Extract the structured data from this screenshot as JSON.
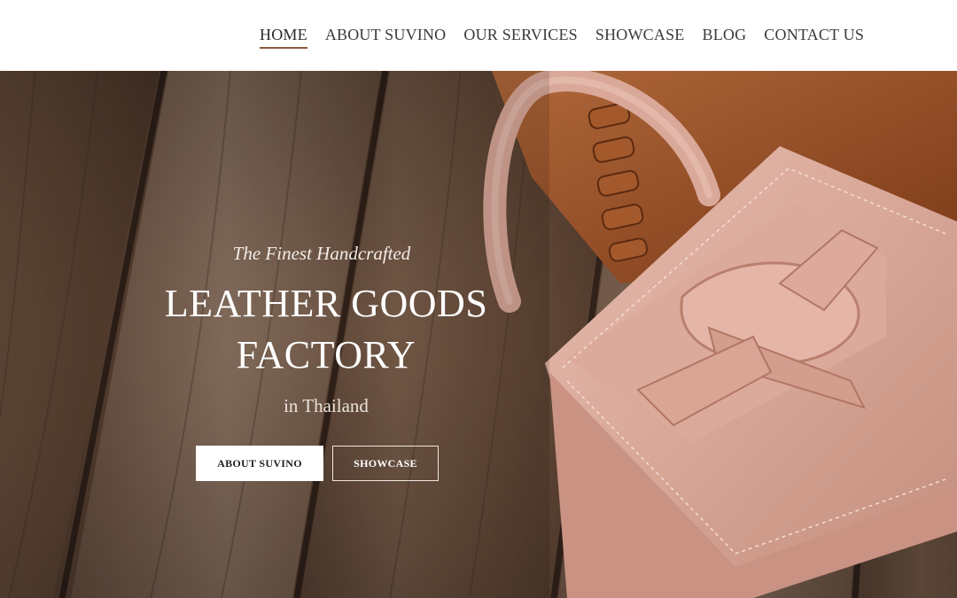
{
  "nav": {
    "items": [
      {
        "label": "HOME",
        "active": true
      },
      {
        "label": "ABOUT SUVINO",
        "active": false
      },
      {
        "label": "OUR SERVICES",
        "active": false
      },
      {
        "label": "SHOWCASE",
        "active": false
      },
      {
        "label": "BLOG",
        "active": false
      },
      {
        "label": "CONTACT US",
        "active": false
      }
    ]
  },
  "hero": {
    "tagline": "The Finest Handcrafted",
    "headline_line1": "LEATHER GOODS",
    "headline_line2": "FACTORY",
    "subtitle": "in Thailand",
    "primary_button": "ABOUT SUVINO",
    "secondary_button": "SHOWCASE"
  },
  "colors": {
    "nav_active_underline": "#8a5a3c",
    "bag_pink": "#d9aa9c",
    "bag_tan": "#9c4f26",
    "wood": "#7a5b45"
  }
}
